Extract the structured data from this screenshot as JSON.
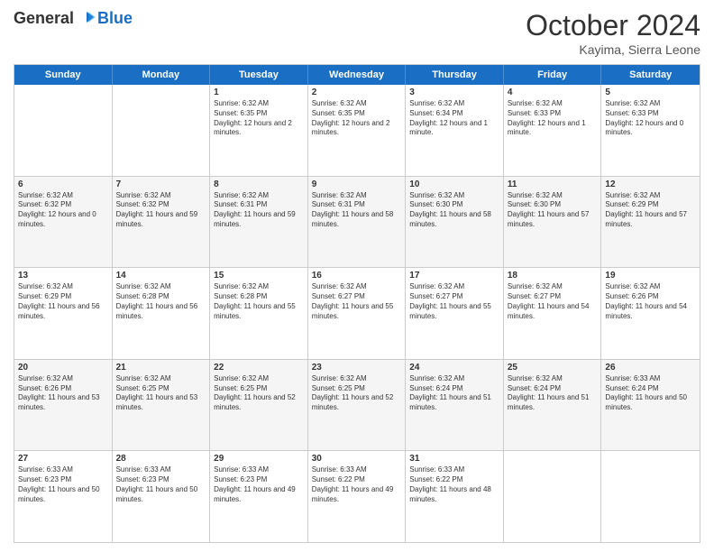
{
  "header": {
    "logo_general": "General",
    "logo_blue": "Blue",
    "month_title": "October 2024",
    "subtitle": "Kayima, Sierra Leone"
  },
  "days_of_week": [
    "Sunday",
    "Monday",
    "Tuesday",
    "Wednesday",
    "Thursday",
    "Friday",
    "Saturday"
  ],
  "rows": [
    [
      {
        "day": "",
        "text": ""
      },
      {
        "day": "",
        "text": ""
      },
      {
        "day": "1",
        "text": "Sunrise: 6:32 AM\nSunset: 6:35 PM\nDaylight: 12 hours and 2 minutes."
      },
      {
        "day": "2",
        "text": "Sunrise: 6:32 AM\nSunset: 6:35 PM\nDaylight: 12 hours and 2 minutes."
      },
      {
        "day": "3",
        "text": "Sunrise: 6:32 AM\nSunset: 6:34 PM\nDaylight: 12 hours and 1 minute."
      },
      {
        "day": "4",
        "text": "Sunrise: 6:32 AM\nSunset: 6:33 PM\nDaylight: 12 hours and 1 minute."
      },
      {
        "day": "5",
        "text": "Sunrise: 6:32 AM\nSunset: 6:33 PM\nDaylight: 12 hours and 0 minutes."
      }
    ],
    [
      {
        "day": "6",
        "text": "Sunrise: 6:32 AM\nSunset: 6:32 PM\nDaylight: 12 hours and 0 minutes."
      },
      {
        "day": "7",
        "text": "Sunrise: 6:32 AM\nSunset: 6:32 PM\nDaylight: 11 hours and 59 minutes."
      },
      {
        "day": "8",
        "text": "Sunrise: 6:32 AM\nSunset: 6:31 PM\nDaylight: 11 hours and 59 minutes."
      },
      {
        "day": "9",
        "text": "Sunrise: 6:32 AM\nSunset: 6:31 PM\nDaylight: 11 hours and 58 minutes."
      },
      {
        "day": "10",
        "text": "Sunrise: 6:32 AM\nSunset: 6:30 PM\nDaylight: 11 hours and 58 minutes."
      },
      {
        "day": "11",
        "text": "Sunrise: 6:32 AM\nSunset: 6:30 PM\nDaylight: 11 hours and 57 minutes."
      },
      {
        "day": "12",
        "text": "Sunrise: 6:32 AM\nSunset: 6:29 PM\nDaylight: 11 hours and 57 minutes."
      }
    ],
    [
      {
        "day": "13",
        "text": "Sunrise: 6:32 AM\nSunset: 6:29 PM\nDaylight: 11 hours and 56 minutes."
      },
      {
        "day": "14",
        "text": "Sunrise: 6:32 AM\nSunset: 6:28 PM\nDaylight: 11 hours and 56 minutes."
      },
      {
        "day": "15",
        "text": "Sunrise: 6:32 AM\nSunset: 6:28 PM\nDaylight: 11 hours and 55 minutes."
      },
      {
        "day": "16",
        "text": "Sunrise: 6:32 AM\nSunset: 6:27 PM\nDaylight: 11 hours and 55 minutes."
      },
      {
        "day": "17",
        "text": "Sunrise: 6:32 AM\nSunset: 6:27 PM\nDaylight: 11 hours and 55 minutes."
      },
      {
        "day": "18",
        "text": "Sunrise: 6:32 AM\nSunset: 6:27 PM\nDaylight: 11 hours and 54 minutes."
      },
      {
        "day": "19",
        "text": "Sunrise: 6:32 AM\nSunset: 6:26 PM\nDaylight: 11 hours and 54 minutes."
      }
    ],
    [
      {
        "day": "20",
        "text": "Sunrise: 6:32 AM\nSunset: 6:26 PM\nDaylight: 11 hours and 53 minutes."
      },
      {
        "day": "21",
        "text": "Sunrise: 6:32 AM\nSunset: 6:25 PM\nDaylight: 11 hours and 53 minutes."
      },
      {
        "day": "22",
        "text": "Sunrise: 6:32 AM\nSunset: 6:25 PM\nDaylight: 11 hours and 52 minutes."
      },
      {
        "day": "23",
        "text": "Sunrise: 6:32 AM\nSunset: 6:25 PM\nDaylight: 11 hours and 52 minutes."
      },
      {
        "day": "24",
        "text": "Sunrise: 6:32 AM\nSunset: 6:24 PM\nDaylight: 11 hours and 51 minutes."
      },
      {
        "day": "25",
        "text": "Sunrise: 6:32 AM\nSunset: 6:24 PM\nDaylight: 11 hours and 51 minutes."
      },
      {
        "day": "26",
        "text": "Sunrise: 6:33 AM\nSunset: 6:24 PM\nDaylight: 11 hours and 50 minutes."
      }
    ],
    [
      {
        "day": "27",
        "text": "Sunrise: 6:33 AM\nSunset: 6:23 PM\nDaylight: 11 hours and 50 minutes."
      },
      {
        "day": "28",
        "text": "Sunrise: 6:33 AM\nSunset: 6:23 PM\nDaylight: 11 hours and 50 minutes."
      },
      {
        "day": "29",
        "text": "Sunrise: 6:33 AM\nSunset: 6:23 PM\nDaylight: 11 hours and 49 minutes."
      },
      {
        "day": "30",
        "text": "Sunrise: 6:33 AM\nSunset: 6:22 PM\nDaylight: 11 hours and 49 minutes."
      },
      {
        "day": "31",
        "text": "Sunrise: 6:33 AM\nSunset: 6:22 PM\nDaylight: 11 hours and 48 minutes."
      },
      {
        "day": "",
        "text": ""
      },
      {
        "day": "",
        "text": ""
      }
    ]
  ]
}
